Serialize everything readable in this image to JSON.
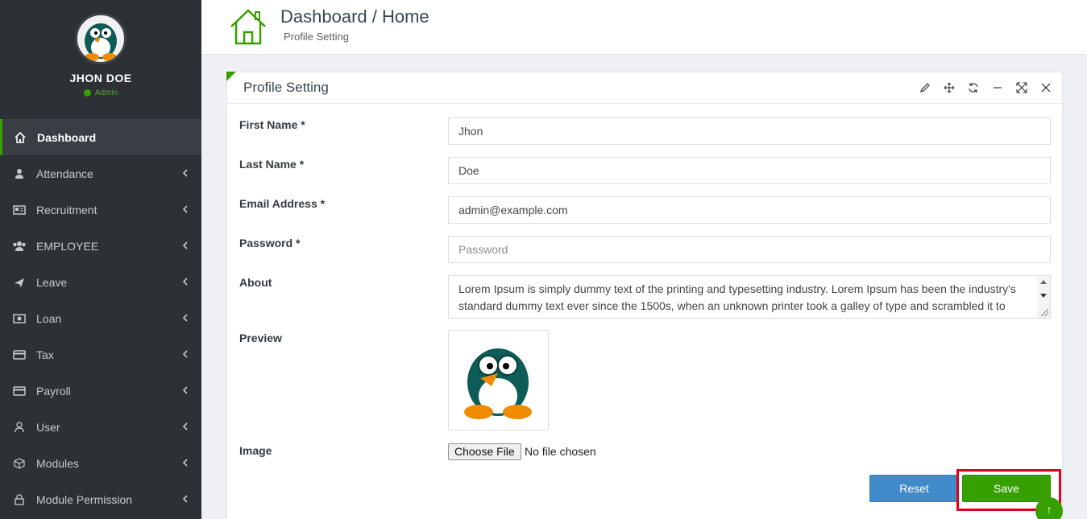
{
  "user": {
    "name": "JHON DOE",
    "role": "Admin"
  },
  "menu": [
    {
      "label": "Dashboard",
      "icon": "home-icon",
      "active": true
    },
    {
      "label": "Attendance",
      "icon": "user-icon"
    },
    {
      "label": "Recruitment",
      "icon": "newspaper-icon"
    },
    {
      "label": "EMPLOYEE",
      "icon": "users-icon"
    },
    {
      "label": "Leave",
      "icon": "plane-icon"
    },
    {
      "label": "Loan",
      "icon": "money-icon"
    },
    {
      "label": "Tax",
      "icon": "card-icon"
    },
    {
      "label": "Payroll",
      "icon": "card-icon"
    },
    {
      "label": "User",
      "icon": "user-outline-icon"
    },
    {
      "label": "Modules",
      "icon": "cube-icon"
    },
    {
      "label": "Module Permission",
      "icon": "lock-icon"
    }
  ],
  "header": {
    "title": "Dashboard / Home",
    "subtitle": "Profile Setting"
  },
  "panel": {
    "title": "Profile Setting"
  },
  "form": {
    "first_name": {
      "label": "First Name *",
      "value": "Jhon"
    },
    "last_name": {
      "label": "Last Name *",
      "value": "Doe"
    },
    "email": {
      "label": "Email Address *",
      "value": "admin@example.com"
    },
    "password": {
      "label": "Password *",
      "placeholder": "Password"
    },
    "about": {
      "label": "About",
      "value": "Lorem Ipsum is simply dummy text of the printing and typesetting industry. Lorem Ipsum has been the industry's standard dummy text ever since the 1500s, when an unknown printer took a galley of type and scrambled it to make a type specimen book. It has survived not only five centuries, but also the leap into"
    },
    "preview": {
      "label": "Preview"
    },
    "image": {
      "label": "Image",
      "button": "Choose File",
      "status": "No file chosen"
    }
  },
  "buttons": {
    "reset": "Reset",
    "save": "Save"
  },
  "float_badge": "↑",
  "colors": {
    "sidebar": "#2d3035",
    "accent": "#37a000",
    "reset": "#428bca",
    "highlight": "#e0001b"
  }
}
